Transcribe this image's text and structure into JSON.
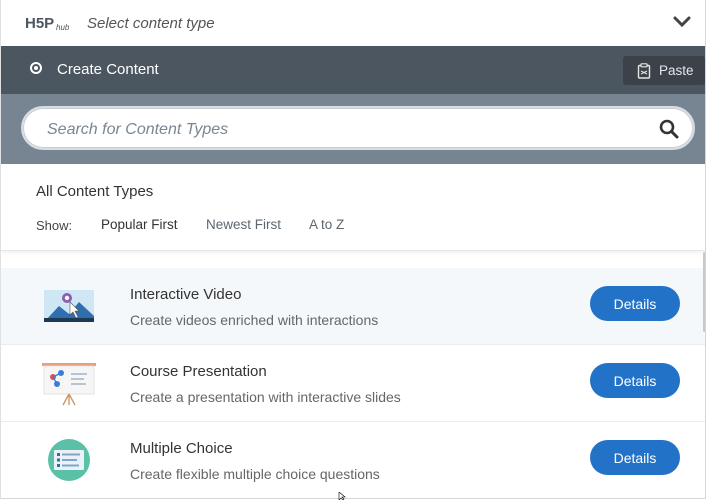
{
  "hub": {
    "logo_text": "H5P hub",
    "title": "Select content type"
  },
  "create_bar": {
    "label": "Create Content",
    "paste_label": "Paste"
  },
  "search": {
    "placeholder": "Search for Content Types",
    "value": ""
  },
  "types": {
    "title": "All Content Types",
    "show_label": "Show:",
    "sort_options": [
      "Popular First",
      "Newest First",
      "A to Z"
    ],
    "selected_sort": "Popular First"
  },
  "items": [
    {
      "title": "Interactive Video",
      "description": "Create videos enriched with interactions",
      "button": "Details",
      "icon": "interactive-video-icon"
    },
    {
      "title": "Course Presentation",
      "description": "Create a presentation with interactive slides",
      "button": "Details",
      "icon": "course-presentation-icon"
    },
    {
      "title": "Multiple Choice",
      "description": "Create flexible multiple choice questions",
      "button": "Details",
      "icon": "multiple-choice-icon"
    }
  ],
  "colors": {
    "create_bar": "#4b5660",
    "search_strip": "#778592",
    "details_button": "#2273c8"
  }
}
